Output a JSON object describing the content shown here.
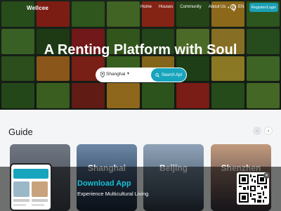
{
  "nav": {
    "logo": "Wellcee",
    "links": [
      "Home",
      "Houses",
      "Community",
      "About Us"
    ],
    "language": "EN",
    "register_login": "Register/Login"
  },
  "hero": {
    "headline": "A Renting Platform with Soul",
    "search": {
      "city": "Shanghai",
      "button": "Search Apt"
    }
  },
  "guide": {
    "title": "Guide",
    "cards": [
      "Shanghai",
      "Beijing",
      "Shenzhen",
      "Shanghai"
    ]
  },
  "download": {
    "title": "Download App",
    "subtitle": "Experience Multicultural Living"
  },
  "icons": [
    "globe-icon",
    "chevron-down-icon",
    "map-pin-icon",
    "search-icon",
    "chevron-left-icon",
    "chevron-right-icon",
    "qr-code-icon",
    "close-icon"
  ],
  "colors": {
    "accent": "#17a5bd",
    "download_title": "#17c0d4"
  }
}
